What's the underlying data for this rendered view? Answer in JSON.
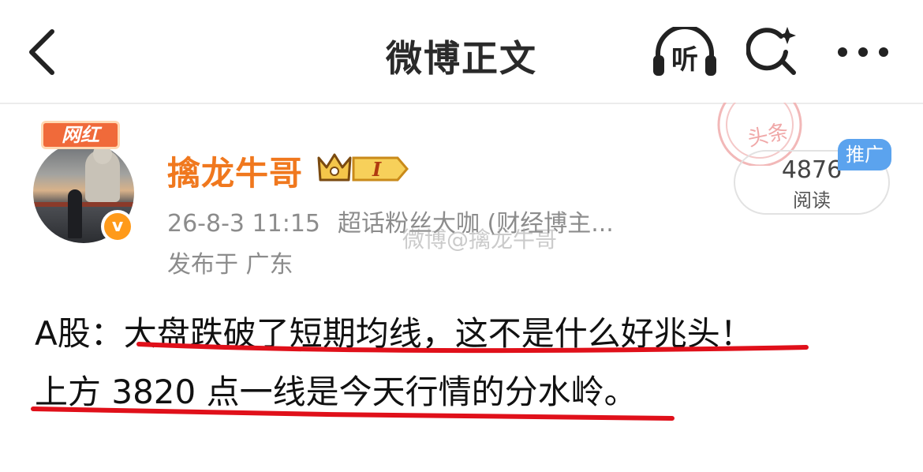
{
  "header": {
    "title": "微博正文",
    "back_icon": "chevron-left-icon",
    "listen_label": "听",
    "search_icon": "sparkle-search-icon",
    "more_icon": "more-dots-icon"
  },
  "stamp": {
    "text": "头条"
  },
  "author": {
    "badge": "网红",
    "name": "擒龙牛哥",
    "verified_mark": "v",
    "level_badge": "I",
    "time": "26-8-3 11:15",
    "source": "超话粉丝大咖 (财经博主...",
    "location": "发布于 广东",
    "name_color": "#f0781e"
  },
  "stats": {
    "reads_count": "4876",
    "reads_label": "阅读",
    "promo_tag": "推广"
  },
  "watermark": "微博@擒龙牛哥",
  "post": {
    "line1_prefix": "A股：",
    "line1_main": "大盘跌破了短期均线，这不是什么好兆头！",
    "line2": "上方 3820 点一线是今天行情的分水岭。",
    "underline_color": "#e0101a"
  }
}
